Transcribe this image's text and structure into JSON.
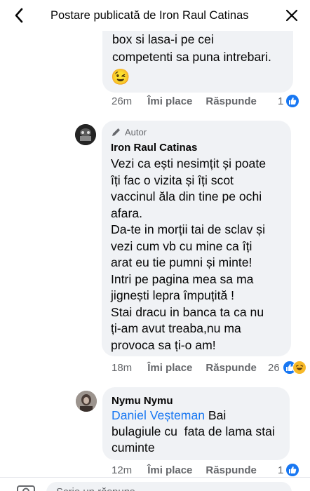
{
  "header": {
    "title": "Postare publicată de Iron Raul Catinas"
  },
  "comment1": {
    "text_line1": "box si lasa-i pe cei",
    "text_line2": "competenti sa puna intrebari.",
    "emoji": "😉",
    "time": "26m",
    "like_label": "Îmi place",
    "reply_label": "Răspunde",
    "reaction_count": "1"
  },
  "comment2": {
    "author_badge": "Autor",
    "author": "Iron Raul Catinas",
    "lines": [
      "Vezi ca ești nesimțit și poate",
      "îți fac o vizita și îți scot",
      "vaccinul ăla din tine pe ochi",
      "afara.",
      "Da-te in morții tai de sclav și",
      "vezi cum vb cu mine ca îți",
      "arat eu tie pumni și minte!",
      "Intri pe pagina mea sa ma",
      "jignești lepra împuțită !",
      "Stai dracu in banca ta ca nu",
      "ți-am avut treaba,nu ma",
      "provoca sa ți-o am!"
    ],
    "time": "18m",
    "like_label": "Îmi place",
    "reply_label": "Răspunde",
    "reaction_count": "26"
  },
  "comment3": {
    "author": "Nymu Nymu",
    "mention": "Daniel Veșteman",
    "text_after_mention": " Bai",
    "line2": "bulagiule cu  fata de lama stai",
    "line3": "cuminte",
    "time": "12m",
    "like_label": "Îmi place",
    "reply_label": "Răspunde",
    "reaction_count": "1"
  },
  "composer": {
    "placeholder": "Scrie un răspuns..."
  },
  "colors": {
    "link": "#1877f2",
    "bubble": "#f0f2f5",
    "secondary_text": "#65676b"
  }
}
